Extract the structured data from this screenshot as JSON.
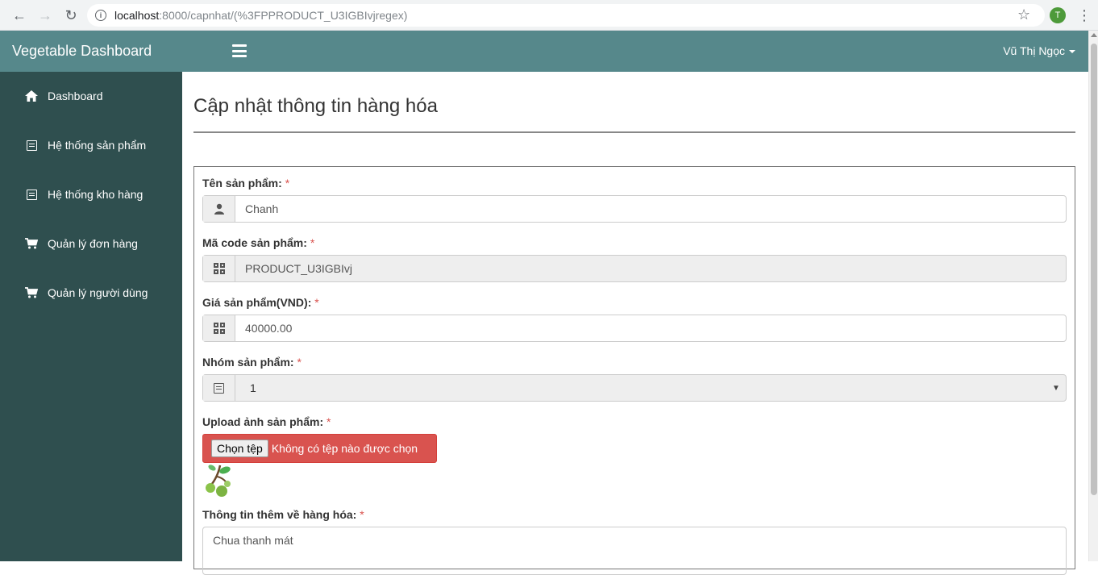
{
  "browser": {
    "url_host": "localhost",
    "url_path": ":8000/capnhat/(%3FPPRODUCT_U3IGBIvjregex)",
    "profile_initial": "T"
  },
  "navbar": {
    "brand": "Vegetable Dashboard",
    "user_name": "Vũ Thị Ngọc"
  },
  "sidebar": {
    "items": [
      {
        "label": "Dashboard",
        "icon": "home-icon"
      },
      {
        "label": "Hệ thống sản phẩm",
        "icon": "list-icon"
      },
      {
        "label": "Hệ thống kho hàng",
        "icon": "list-icon"
      },
      {
        "label": "Quản lý đơn hàng",
        "icon": "cart-icon"
      },
      {
        "label": "Quản lý người dùng",
        "icon": "cart-icon"
      }
    ]
  },
  "page": {
    "title": "Cập nhật thông tin hàng hóa"
  },
  "form": {
    "required_mark": "*",
    "name_label": "Tên sản phẩm:",
    "name_value": "Chanh",
    "code_label": "Mã code sản phẩm:",
    "code_value": "PRODUCT_U3IGBIvj",
    "price_label": "Giá sản phẩm(VND):",
    "price_value": "40000.00",
    "group_label": "Nhóm sản phẩm:",
    "group_value": "1",
    "upload_label": "Upload ảnh sản phẩm:",
    "upload_button": "Chọn tệp",
    "upload_status": "Không có tệp nào được chọn",
    "info_label": "Thông tin thêm về hàng hóa:",
    "info_value": "Chua thanh mát"
  },
  "colors": {
    "navbar": "#56888b",
    "sidebar": "#2f4f4f",
    "upload_bg": "#d9534f",
    "required": "#d9534f"
  }
}
